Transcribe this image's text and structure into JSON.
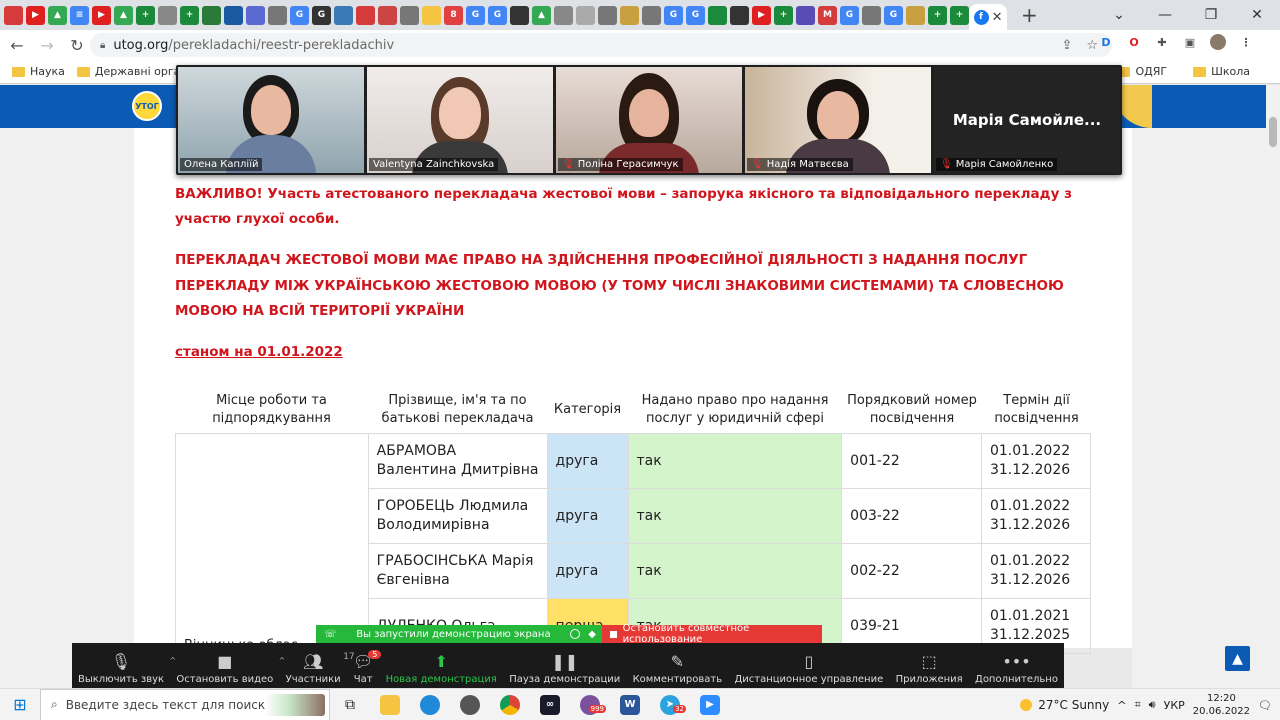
{
  "browser": {
    "url_host": "utog.org",
    "url_path": "/perekladachi/reestr-perekladachiv",
    "bookmarks": [
      {
        "label": "Наука"
      },
      {
        "label": "Державні органи"
      }
    ],
    "bookmarks_right": [
      {
        "label": "ОДЯГ"
      },
      {
        "label": "Школа"
      }
    ]
  },
  "zoom": {
    "participants": [
      {
        "name": "Олена Капліїй",
        "muted": false
      },
      {
        "name": "Valentyna Zainchkovska",
        "muted": false
      },
      {
        "name": "Поліна Герасимчук",
        "muted": true
      },
      {
        "name": "Надія Матвєєва",
        "muted": true
      },
      {
        "name": "Марія Самойленко",
        "muted": true
      }
    ],
    "blank_tile_title": "Марія  Самойле...",
    "share_notice": "Вы запустили демонстрацию экрана",
    "stop_share": "Остановить совместное использование",
    "participant_count": "17",
    "chat_badge": "5",
    "toolbar": [
      {
        "label": "Выключить звук",
        "icon": "microphone-icon"
      },
      {
        "label": "Остановить видео",
        "icon": "video-camera-icon"
      },
      {
        "label": "Участники",
        "icon": "participants-icon"
      },
      {
        "label": "Чат",
        "icon": "chat-icon"
      },
      {
        "label": "Новая демонстрация",
        "icon": "share-screen-icon"
      },
      {
        "label": "Пауза демонстрации",
        "icon": "pause-icon"
      },
      {
        "label": "Комментировать",
        "icon": "annotate-pen-icon"
      },
      {
        "label": "Дистанционное управление",
        "icon": "mouse-icon"
      },
      {
        "label": "Приложения",
        "icon": "apps-icon"
      },
      {
        "label": "Дополнительно",
        "icon": "more-dots-icon"
      }
    ]
  },
  "page": {
    "important": "ВАЖЛИВО! Участь атестованого перекладача жестової мови – запорука якісного та відповідального перекладу з участю глухої особи.",
    "rights": "ПЕРЕКЛАДАЧ ЖЕСТОВОЇ МОВИ МАЄ ПРАВО НА ЗДІЙСНЕННЯ ПРОФЕСІЙНОЇ ДІЯЛЬНОСТІ З НАДАННЯ ПОСЛУГ ПЕРЕКЛАДУ МІЖ УКРАЇНСЬКОЮ ЖЕСТОВОЮ МОВОЮ (У ТОМУ ЧИСЛІ ЗНАКОВИМИ СИСТЕМАМИ) ТА СЛОВЕСНОЮ МОВОЮ НА ВСІЙ ТЕРИТОРІЇ УКРАЇНИ",
    "as_of": "станом на 01.01.2022",
    "headers": [
      "Місце роботи та підпорядкування",
      "Прізвище, ім'я та по батькові перекладача",
      "Категорія",
      "Надано право про надання послуг у юридичній сфері",
      "Порядковий номер посвідчення",
      "Термін дії посвідчення"
    ],
    "rows": [
      {
        "name": "АБРАМОВА Валентина Дмитрівна",
        "category": "друга",
        "legal": "так",
        "number": "001-22",
        "from": "01.01.2022",
        "to": "31.12.2026"
      },
      {
        "name": "ГОРОБЕЦЬ Людмила Володимирівна",
        "category": "друга",
        "legal": "так",
        "number": "003-22",
        "from": "01.01.2022",
        "to": "31.12.2026"
      },
      {
        "name": "ГРАБОСІНСЬКА Марія Євгенівна",
        "category": "друга",
        "legal": "так",
        "number": "002-22",
        "from": "01.01.2022",
        "to": "31.12.2026"
      },
      {
        "name": "ДУЛЕНКО Ольга",
        "category": "перша",
        "legal": "так",
        "number": "039-21",
        "from": "01.01.2021",
        "to": "31.12.2025"
      }
    ],
    "workplace_partial": "Вінницька облас"
  },
  "taskbar": {
    "search_placeholder": "Введите здесь текст для поиска",
    "weather": "27°C  Sunny",
    "lang": "УКР",
    "time": "12:20",
    "date": "20.06.2022",
    "viber_badge": "999",
    "telegram_badge": "32"
  },
  "colors": {
    "accent_red": "#d0161d",
    "site_blue": "#0b5bb5",
    "category_blue": "#cce5f6",
    "category_yellow": "#ffe066",
    "legal_green": "#d4f5cc",
    "zoom_green": "#25b83a",
    "zoom_red": "#e53935"
  }
}
